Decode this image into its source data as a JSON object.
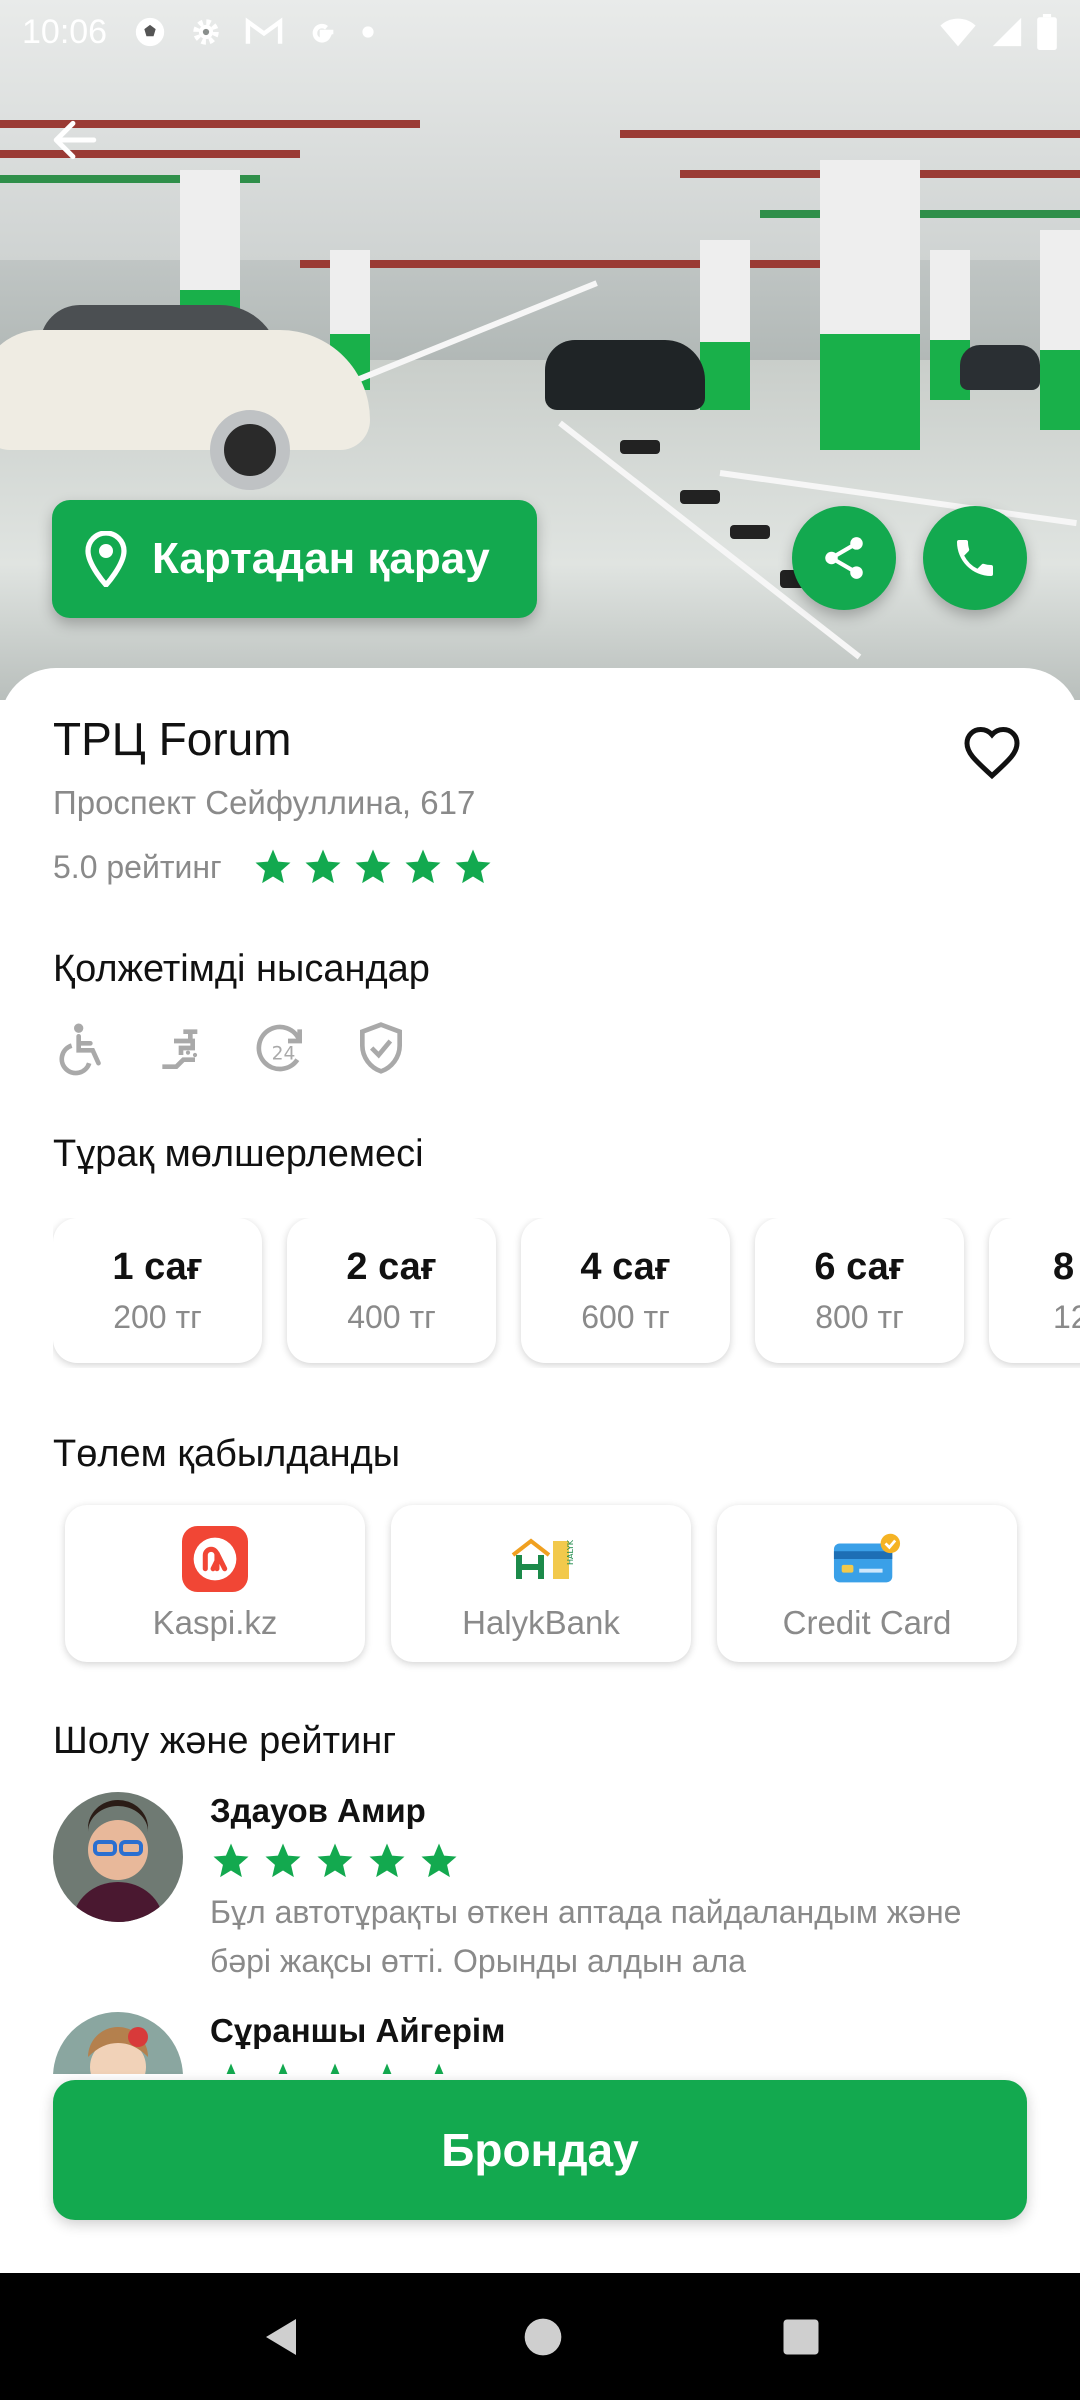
{
  "status_bar": {
    "time": "10:06",
    "left_icons": [
      "soccer-ball-icon",
      "gear-icon",
      "gmail-icon",
      "google-icon",
      "dot-icon"
    ],
    "right_icons": [
      "wifi-icon",
      "signal-icon",
      "battery-icon"
    ]
  },
  "hero": {
    "map_button_label": "Картадан қарау"
  },
  "parking": {
    "name": "ТРЦ Forum",
    "address": "Проспект Сейфуллина, 617",
    "rating_text": "5.0 рейтинг",
    "rating": 5
  },
  "amenities": {
    "title": "Қолжетімді нысандар",
    "icons": [
      "wheelchair-icon",
      "car-wash-icon",
      "24-hours-icon",
      "security-shield-icon"
    ]
  },
  "rates": {
    "title": "Тұрақ мөлшерлемесі",
    "items": [
      {
        "hours": "1 сағ",
        "price": "200 тг"
      },
      {
        "hours": "2 сағ",
        "price": "400 тг"
      },
      {
        "hours": "4 сағ",
        "price": "600 тг"
      },
      {
        "hours": "6 сағ",
        "price": "800 тг"
      },
      {
        "hours": "8",
        "price": "12"
      }
    ]
  },
  "payments": {
    "title": "Төлем қабылданды",
    "items": [
      {
        "name": "Kaspi.kz",
        "logo": "kaspi-logo-icon"
      },
      {
        "name": "HalykBank",
        "logo": "halyk-logo-icon"
      },
      {
        "name": "Credit Card",
        "logo": "credit-card-icon"
      }
    ]
  },
  "reviews": {
    "title": "Шолу және рейтинг",
    "items": [
      {
        "name": "Здауов Амир",
        "stars": 5,
        "text": "Бұл автотұрақты өткен аптада пайдаландым және бәрі жақсы өтті. Орынды алдын ала"
      },
      {
        "name": "Сұраншы Айгерім",
        "stars": 5,
        "text": ""
      }
    ]
  },
  "book_button_label": "Брондау",
  "colors": {
    "accent": "#13a94f",
    "muted_text": "#8a8a8a"
  }
}
